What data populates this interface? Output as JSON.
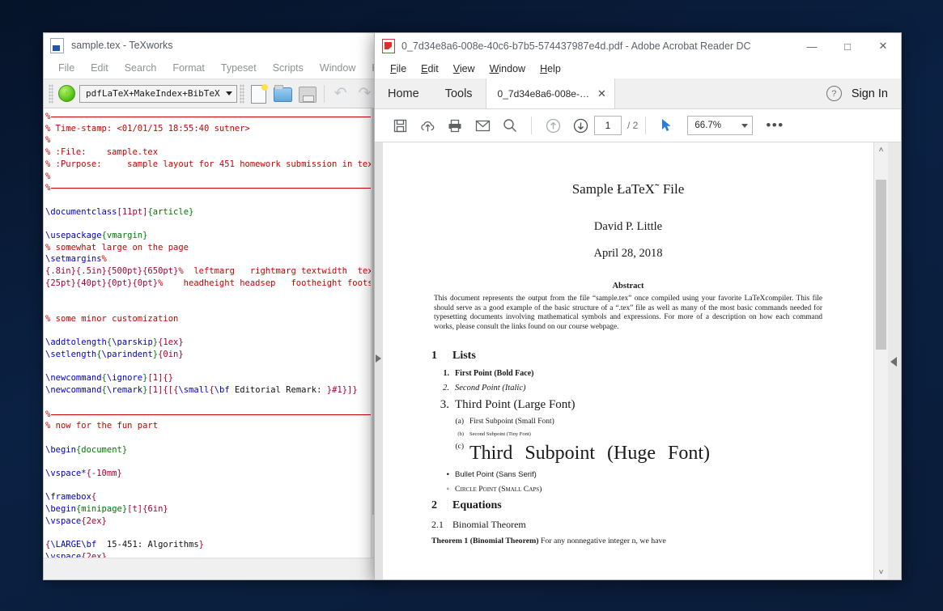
{
  "desktop": {
    "background": "#0a1b38"
  },
  "texworks": {
    "title": "sample.tex - TeXworks",
    "doc_icon": "tex-document-icon",
    "menus": [
      "File",
      "Edit",
      "Search",
      "Format",
      "Typeset",
      "Scripts",
      "Window",
      "Help"
    ],
    "toolbar": {
      "run_button": "typeset-run-button",
      "engine": "pdfLaTeX+MakeIndex+BibTeX",
      "icons": [
        "new-document-icon",
        "open-folder-icon",
        "save-icon",
        "undo-icon",
        "redo-icon"
      ]
    },
    "code_lines": [
      {
        "type": "rule"
      },
      {
        "type": "code",
        "spans": [
          {
            "c": "com",
            "t": "% Time-stamp: <01/01/15 18:55:40 sutner>"
          }
        ]
      },
      {
        "type": "code",
        "spans": [
          {
            "c": "com",
            "t": "%"
          }
        ]
      },
      {
        "type": "code",
        "spans": [
          {
            "c": "com",
            "t": "% :File:    sample.tex"
          }
        ]
      },
      {
        "type": "code",
        "spans": [
          {
            "c": "com",
            "t": "% :Purpose:     sample layout for 451 homework submission in tex"
          }
        ]
      },
      {
        "type": "code",
        "spans": [
          {
            "c": "com",
            "t": "%"
          }
        ]
      },
      {
        "type": "rule"
      },
      {
        "type": "blank"
      },
      {
        "type": "code",
        "spans": [
          {
            "c": "cmd",
            "t": "\\documentclass"
          },
          {
            "c": "arg",
            "t": "[11pt]"
          },
          {
            "c": "env",
            "t": "{article}"
          }
        ]
      },
      {
        "type": "blank"
      },
      {
        "type": "code",
        "spans": [
          {
            "c": "cmd",
            "t": "\\usepackage"
          },
          {
            "c": "env",
            "t": "{vmargin}"
          }
        ]
      },
      {
        "type": "code",
        "spans": [
          {
            "c": "com",
            "t": "% somewhat large on the page"
          }
        ]
      },
      {
        "type": "code",
        "spans": [
          {
            "c": "cmd",
            "t": "\\setmargins"
          },
          {
            "c": "com",
            "t": "%"
          }
        ]
      },
      {
        "type": "code",
        "spans": [
          {
            "c": "arg",
            "t": "{.8in}{.5in}{500pt}{650pt}"
          },
          {
            "c": "com",
            "t": "%  leftmarg   rightmarg textwidth  texthei"
          }
        ]
      },
      {
        "type": "code",
        "spans": [
          {
            "c": "arg",
            "t": "{25pt}{40pt}{0pt}{0pt}"
          },
          {
            "c": "com",
            "t": "%    headheight headsep   footheight footskip"
          }
        ]
      },
      {
        "type": "blank"
      },
      {
        "type": "blank"
      },
      {
        "type": "code",
        "spans": [
          {
            "c": "com",
            "t": "% some minor customization"
          }
        ]
      },
      {
        "type": "blank"
      },
      {
        "type": "code",
        "spans": [
          {
            "c": "cmd",
            "t": "\\addtolength"
          },
          {
            "c": "env",
            "t": "{"
          },
          {
            "c": "cmd",
            "t": "\\parskip"
          },
          {
            "c": "env",
            "t": "}"
          },
          {
            "c": "arg",
            "t": "{1ex}"
          }
        ]
      },
      {
        "type": "code",
        "spans": [
          {
            "c": "cmd",
            "t": "\\setlength"
          },
          {
            "c": "env",
            "t": "{"
          },
          {
            "c": "cmd",
            "t": "\\parindent"
          },
          {
            "c": "env",
            "t": "}"
          },
          {
            "c": "arg",
            "t": "{0in}"
          }
        ]
      },
      {
        "type": "blank"
      },
      {
        "type": "code",
        "spans": [
          {
            "c": "cmd",
            "t": "\\newcommand"
          },
          {
            "c": "env",
            "t": "{"
          },
          {
            "c": "cmd",
            "t": "\\ignore"
          },
          {
            "c": "env",
            "t": "}"
          },
          {
            "c": "arg",
            "t": "[1]{}"
          }
        ]
      },
      {
        "type": "code",
        "spans": [
          {
            "c": "cmd",
            "t": "\\newcommand"
          },
          {
            "c": "env",
            "t": "{"
          },
          {
            "c": "cmd",
            "t": "\\remark"
          },
          {
            "c": "env",
            "t": "}"
          },
          {
            "c": "arg",
            "t": "[1]{[{"
          },
          {
            "c": "cmd",
            "t": "\\small"
          },
          {
            "c": "arg",
            "t": "{"
          },
          {
            "c": "cmd",
            "t": "\\bf "
          },
          {
            "c": "txt",
            "t": "Editorial Remark: "
          },
          {
            "c": "arg",
            "t": "}#1}]}"
          }
        ]
      },
      {
        "type": "blank"
      },
      {
        "type": "rule"
      },
      {
        "type": "code",
        "spans": [
          {
            "c": "com",
            "t": "% now for the fun part"
          }
        ]
      },
      {
        "type": "blank"
      },
      {
        "type": "code",
        "spans": [
          {
            "c": "cmd",
            "t": "\\begin"
          },
          {
            "c": "env",
            "t": "{document}"
          }
        ]
      },
      {
        "type": "blank"
      },
      {
        "type": "code",
        "spans": [
          {
            "c": "cmd",
            "t": "\\vspace*"
          },
          {
            "c": "arg",
            "t": "{-10mm}"
          }
        ]
      },
      {
        "type": "blank"
      },
      {
        "type": "code",
        "spans": [
          {
            "c": "cmd",
            "t": "\\framebox"
          },
          {
            "c": "arg",
            "t": "{"
          }
        ]
      },
      {
        "type": "code",
        "spans": [
          {
            "c": "cmd",
            "t": "\\begin"
          },
          {
            "c": "env",
            "t": "{minipage}"
          },
          {
            "c": "arg",
            "t": "[t]{6in}"
          }
        ]
      },
      {
        "type": "code",
        "spans": [
          {
            "c": "cmd",
            "t": "\\vspace"
          },
          {
            "c": "arg",
            "t": "{2ex}"
          }
        ]
      },
      {
        "type": "blank"
      },
      {
        "type": "code",
        "spans": [
          {
            "c": "arg",
            "t": "{"
          },
          {
            "c": "cmd",
            "t": "\\LARGE"
          },
          {
            "c": "cmd",
            "t": "\\bf "
          },
          {
            "c": "txt",
            "t": " 15-451: Algorithms"
          },
          {
            "c": "arg",
            "t": "}"
          }
        ]
      },
      {
        "type": "code",
        "spans": [
          {
            "c": "cmd",
            "t": "\\vspace"
          },
          {
            "c": "arg",
            "t": "{2ex}"
          }
        ]
      },
      {
        "type": "blank"
      }
    ],
    "collapse_arrow": "panel-collapse-arrow"
  },
  "acrobat": {
    "title": "0_7d34e8a6-008e-40c6-b7b5-574437987e4d.pdf - Adobe Acrobat Reader DC",
    "pdf_icon": "pdf-file-icon",
    "window_controls": {
      "minimize": "—",
      "maximize": "□",
      "close": "✕"
    },
    "menus": [
      {
        "pre": "",
        "key": "F",
        "post": "ile"
      },
      {
        "pre": "",
        "key": "E",
        "post": "dit"
      },
      {
        "pre": "",
        "key": "V",
        "post": "iew"
      },
      {
        "pre": "",
        "key": "W",
        "post": "indow"
      },
      {
        "pre": "",
        "key": "H",
        "post": "elp"
      }
    ],
    "tabs": {
      "home": "Home",
      "tools": "Tools",
      "document": "0_7d34e8a6-008e-…",
      "close_glyph": "✕"
    },
    "help_glyph": "?",
    "sign_in": "Sign In",
    "toolbar": {
      "icons": [
        "save-icon",
        "upload-cloud-icon",
        "print-icon",
        "email-icon",
        "search-icon",
        "previous-page-icon",
        "next-page-icon"
      ],
      "page_current": "1",
      "page_total": "/ 2",
      "select-tool": "select-cursor-icon",
      "zoom_level": "66.7%",
      "more_glyph": "•••"
    },
    "scrollbar": {
      "up_glyph": "˄",
      "down_glyph": "˅"
    },
    "panel_arrow": "right-panel-expand-arrow"
  },
  "pdf": {
    "title": "Sample ŁaTeX˜ File",
    "author": "David P. Little",
    "date": "April 28, 2018",
    "abstract_heading": "Abstract",
    "abstract_body": "This document represents the output from the file “sample.tex”   once compiled using your favorite LaTeXcompiler. This file should serve as a good example of the basic structure of a “.tex”   file as well as many of the most basic commands needed for typesetting documents involving mathematical symbols and expressions. For more of a description on how each command works, please consult the links found on our course webpage.",
    "section1": {
      "number": "1",
      "title": "Lists"
    },
    "list_items": [
      {
        "marker": "1.",
        "text": "First Point (Bold Face)",
        "style": "li-bold",
        "level": 1
      },
      {
        "marker": "2.",
        "text": "Second Point (Italic)",
        "style": "li-ital",
        "level": 1
      },
      {
        "marker": "3.",
        "text": "Third Point (Large Font)",
        "style": "li-large",
        "level": 1
      },
      {
        "marker": "(a)",
        "text": "First Subpoint (Small Font)",
        "style": "li-small",
        "level": 2
      },
      {
        "marker": "(b)",
        "text": "Second Subpoint (Tiny Font)",
        "style": "li-tiny",
        "level": 2
      },
      {
        "marker": "(c)",
        "text": "Third Subpoint (Huge Font)",
        "style": "li-huge",
        "level": 2
      },
      {
        "marker": "•",
        "text": "Bullet Point (Sans Serif)",
        "style": "li-sans",
        "level": 1
      },
      {
        "marker": "◦",
        "text": "Circle Point (Small Caps)",
        "style": "li-sc",
        "level": 1
      }
    ],
    "section2": {
      "number": "2",
      "title": "Equations"
    },
    "subsection21": {
      "number": "2.1",
      "title": "Binomial Theorem"
    },
    "theorem_label": "Theorem 1 (Binomial Theorem)",
    "theorem_text": " For any nonnegative integer n, we have"
  }
}
